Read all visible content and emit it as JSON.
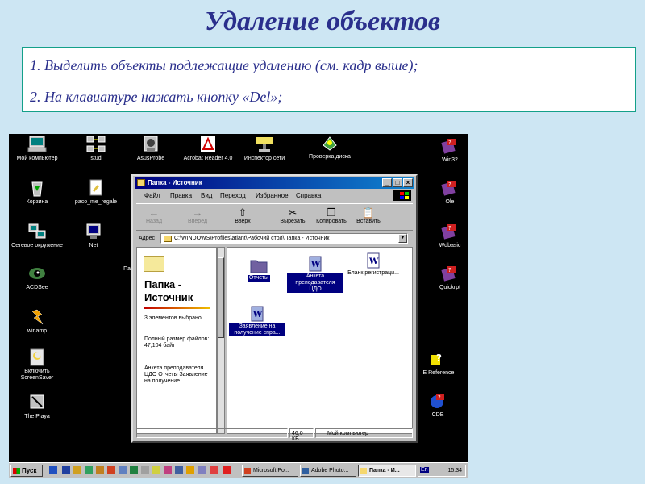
{
  "slide": {
    "title": "Удаление объектов",
    "steps": [
      "1. Выделить объекты подлежащие удалению (см. кадр выше);",
      "2. На клавиатуре нажать кнопку «Del»;"
    ]
  },
  "desktop": {
    "icons": [
      {
        "label": "Мой компьютер",
        "icon": "computer-icon"
      },
      {
        "label": "stud",
        "icon": "network-share-icon"
      },
      {
        "label": "AsusProbe",
        "icon": "asusprobe-icon"
      },
      {
        "label": "Acrobat Reader 4.0",
        "icon": "acrobat-icon"
      },
      {
        "label": "Инспектор сети",
        "icon": "network-inspector-icon"
      },
      {
        "label": "Проверка диска",
        "icon": "disk-check-icon"
      },
      {
        "label": "Win32",
        "icon": "winrar-icon"
      },
      {
        "label": "Корзина",
        "icon": "recycle-bin-icon"
      },
      {
        "label": "paco_me_regale",
        "icon": "document-icon"
      },
      {
        "label": "Ole",
        "icon": "winrar-icon"
      },
      {
        "label": "Сетевое окружение",
        "icon": "network-neighborhood-icon"
      },
      {
        "label": "Net",
        "icon": "network-share-icon"
      },
      {
        "label": "Wdbasic",
        "icon": "winrar-icon"
      },
      {
        "label": "ACDSee",
        "icon": "acdsee-icon"
      },
      {
        "label": "Quickrpt",
        "icon": "winrar-icon"
      },
      {
        "label": "winamp",
        "icon": "winamp-icon"
      },
      {
        "label": "Включить ScreenSaver",
        "icon": "screensaver-icon"
      },
      {
        "label": "IE Reference",
        "icon": "help-icon"
      },
      {
        "label": "The Playa",
        "icon": "playa-icon"
      },
      {
        "label": "CDE",
        "icon": "cde-icon"
      },
      {
        "label": "Па",
        "icon": "folder-icon"
      }
    ]
  },
  "window": {
    "title": "Папка - Источник",
    "menu": [
      "Файл",
      "Правка",
      "Вид",
      "Переход",
      "Избранное",
      "Справка"
    ],
    "toolbar": [
      {
        "label": "Назад",
        "icon": "back-arrow-icon",
        "enabled": false
      },
      {
        "label": "Вперед",
        "icon": "forward-arrow-icon",
        "enabled": false
      },
      {
        "label": "Вверх",
        "icon": "up-folder-icon",
        "enabled": true
      },
      {
        "label": "Вырезать",
        "icon": "cut-icon",
        "enabled": true
      },
      {
        "label": "Копировать",
        "icon": "copy-icon",
        "enabled": true
      },
      {
        "label": "Вставить",
        "icon": "paste-icon",
        "enabled": true
      }
    ],
    "address_label": "Адрес",
    "address_value": "C:\\WINDOWS\\Profiles\\atlant\\Рабочий стол\\Папка - Источник",
    "left_pane": {
      "title_line1": "Папка -",
      "title_line2": "Источник",
      "selected_info": "3 элементов выбрано.",
      "size_info": "Полный размер файлов: 47,104 байт",
      "file_list": "Анкета преподавателя ЦДО Отчеты Заявление на получение"
    },
    "items": [
      {
        "label": "Отчеты",
        "type": "folder",
        "selected": true
      },
      {
        "label": "Анкета преподавателя ЦДО",
        "type": "word-doc",
        "selected": true
      },
      {
        "label": "Бланк регистраци...",
        "type": "word-doc",
        "selected": false
      },
      {
        "label": "Заявление на получение спра...",
        "type": "word-doc",
        "selected": true
      }
    ],
    "status_size": "46,0 КБ",
    "status_location": "Мой компьютер"
  },
  "taskbar": {
    "start_label": "Пуск",
    "tasks": [
      {
        "label": "Microsoft Po...",
        "active": false
      },
      {
        "label": "Adobe Photo...",
        "active": false
      },
      {
        "label": "Папка - И...",
        "active": true
      }
    ],
    "lang": "En",
    "clock": "15:34"
  },
  "colors": {
    "slide_bg": "#cde6f3",
    "title_color": "#2a2f8c",
    "textbox_border": "#13a089",
    "selection": "#000080"
  }
}
